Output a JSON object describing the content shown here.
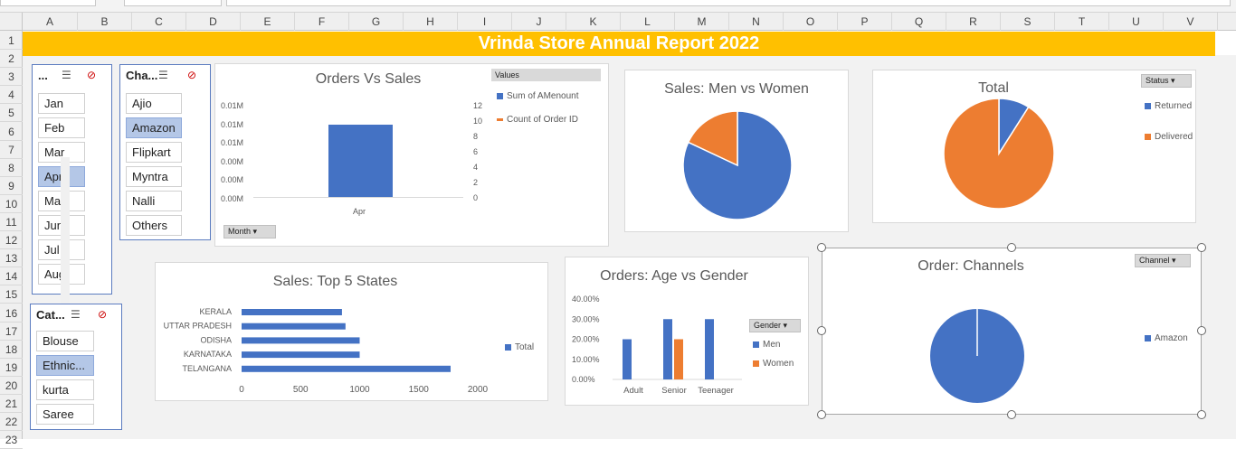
{
  "sheet": {
    "columns": [
      "A",
      "B",
      "C",
      "D",
      "E",
      "F",
      "G",
      "H",
      "I",
      "J",
      "K",
      "L",
      "M",
      "N",
      "O",
      "P",
      "Q",
      "R",
      "S",
      "T",
      "U",
      "V"
    ],
    "rows": [
      "1",
      "2",
      "3",
      "4",
      "5",
      "6",
      "7",
      "8",
      "9",
      "10",
      "11",
      "12",
      "13",
      "14",
      "15",
      "16",
      "17",
      "18",
      "19",
      "20",
      "21",
      "22",
      "23"
    ],
    "title": "Vrinda Store Annual Report 2022"
  },
  "slicers": {
    "month": {
      "header": "...",
      "items": [
        "Jan",
        "Feb",
        "Mar",
        "Apr",
        "May",
        "Jun",
        "Jul",
        "Aug"
      ],
      "selected": "Apr"
    },
    "channel": {
      "header": "Cha...",
      "items": [
        "Ajio",
        "Amazon",
        "Flipkart",
        "Myntra",
        "Nalli",
        "Others"
      ],
      "selected": "Amazon"
    },
    "category": {
      "header": "Cat...",
      "items": [
        "Blouse",
        "Ethnic...",
        "kurta",
        "Saree"
      ],
      "selected": "Ethnic..."
    }
  },
  "orders_sales": {
    "title": "Orders Vs Sales",
    "values_label": "Values",
    "legend": [
      "Sum of AMenount",
      "Count of Order ID"
    ],
    "left_ticks": [
      "0.01M",
      "0.01M",
      "0.01M",
      "0.00M",
      "0.00M",
      "0.00M"
    ],
    "right_ticks": [
      "12",
      "10",
      "8",
      "6",
      "4",
      "2",
      "0"
    ],
    "category": "Apr",
    "filter_label": "Month",
    "colors": {
      "sales": "#4472c4",
      "orders": "#ed7d31"
    }
  },
  "men_women": {
    "title": "Sales: Men vs Women",
    "values": [
      82,
      18
    ],
    "colors": [
      "#4472c4",
      "#ed7d31"
    ]
  },
  "status": {
    "title": "Total",
    "filter_label": "Status",
    "legend": [
      "Returned",
      "Delivered"
    ],
    "values": [
      9,
      91
    ],
    "colors": [
      "#4472c4",
      "#ed7d31"
    ]
  },
  "top_states": {
    "title": "Sales: Top 5 States",
    "legend": "Total",
    "x_ticks": [
      "0",
      "500",
      "1000",
      "1500",
      "2000"
    ],
    "chart_data": {
      "type": "bar",
      "categories": [
        "KERALA",
        "UTTAR PRADESH",
        "ODISHA",
        "KARNATAKA",
        "TELANGANA"
      ],
      "values": [
        850,
        880,
        1000,
        1000,
        1770
      ],
      "xlim": [
        0,
        2000
      ]
    }
  },
  "age_gender": {
    "title": "Orders: Age vs Gender",
    "filter_label": "Gender",
    "legend": [
      "Men",
      "Women"
    ],
    "y_ticks": [
      "40.00%",
      "30.00%",
      "20.00%",
      "10.00%",
      "0.00%"
    ],
    "chart_data": {
      "type": "bar",
      "categories": [
        "Adult",
        "Senior",
        "Teenager"
      ],
      "series": [
        {
          "name": "Men",
          "values": [
            20,
            30,
            30
          ]
        },
        {
          "name": "Women",
          "values": [
            0,
            20,
            0
          ]
        }
      ],
      "ylim": [
        0,
        40
      ]
    }
  },
  "channels": {
    "title": "Order: Channels",
    "filter_label": "Channel",
    "legend": [
      "Amazon"
    ],
    "values": [
      100
    ]
  }
}
